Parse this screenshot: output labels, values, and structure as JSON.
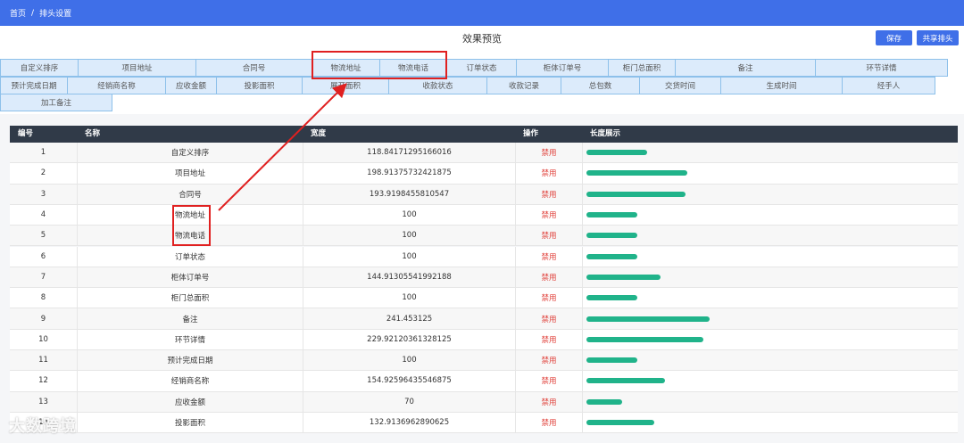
{
  "breadcrumb": {
    "home": "首页",
    "separator": "/",
    "current": "排头设置"
  },
  "page_title": "效果预览",
  "buttons": {
    "save": "保存",
    "share": "共享排头"
  },
  "tabs_row1": [
    "自定义排序",
    "项目地址",
    "合同号",
    "物流地址",
    "物流电话",
    "订单状态",
    "柜体订单号",
    "柜门总面积",
    "备注",
    "环节详情"
  ],
  "tabs_row2": [
    "预计完成日期",
    "经销商名称",
    "应收金额",
    "投影面积",
    "展开面积",
    "收款状态",
    "收款记录",
    "总包数",
    "交货时间",
    "生成时间",
    "经手人"
  ],
  "tabs_row3": [
    "加工备注"
  ],
  "table": {
    "headers": {
      "id": "编号",
      "name": "名称",
      "width": "宽度",
      "op": "操作",
      "bar": "长度展示"
    },
    "rows": [
      {
        "id": "1",
        "name": "自定义排序",
        "width": "118.84171295166016",
        "op": "禁用",
        "bar": 118.84
      },
      {
        "id": "2",
        "name": "项目地址",
        "width": "198.91375732421875",
        "op": "禁用",
        "bar": 198.91
      },
      {
        "id": "3",
        "name": "合同号",
        "width": "193.9198455810547",
        "op": "禁用",
        "bar": 193.92
      },
      {
        "id": "4",
        "name": "物流地址",
        "width": "100",
        "op": "禁用",
        "bar": 100
      },
      {
        "id": "5",
        "name": "物流电话",
        "width": "100",
        "op": "禁用",
        "bar": 100
      },
      {
        "id": "6",
        "name": "订单状态",
        "width": "100",
        "op": "禁用",
        "bar": 100
      },
      {
        "id": "7",
        "name": "柜体订单号",
        "width": "144.91305541992188",
        "op": "禁用",
        "bar": 144.91
      },
      {
        "id": "8",
        "name": "柜门总面积",
        "width": "100",
        "op": "禁用",
        "bar": 100
      },
      {
        "id": "9",
        "name": "备注",
        "width": "241.453125",
        "op": "禁用",
        "bar": 241.45
      },
      {
        "id": "10",
        "name": "环节详情",
        "width": "229.92120361328125",
        "op": "禁用",
        "bar": 229.92
      },
      {
        "id": "11",
        "name": "预计完成日期",
        "width": "100",
        "op": "禁用",
        "bar": 100
      },
      {
        "id": "12",
        "name": "经销商名称",
        "width": "154.92596435546875",
        "op": "禁用",
        "bar": 154.93
      },
      {
        "id": "13",
        "name": "应收金额",
        "width": "70",
        "op": "禁用",
        "bar": 70
      },
      {
        "id": "14",
        "name": "投影面积",
        "width": "132.9136962890625",
        "op": "禁用",
        "bar": 132.91
      }
    ]
  },
  "watermark": "大数跨境",
  "colors": {
    "topbar": "#3f6fe8",
    "bar": "#20b38a",
    "highlight": "#e02020",
    "disabled": "#e0403a"
  }
}
